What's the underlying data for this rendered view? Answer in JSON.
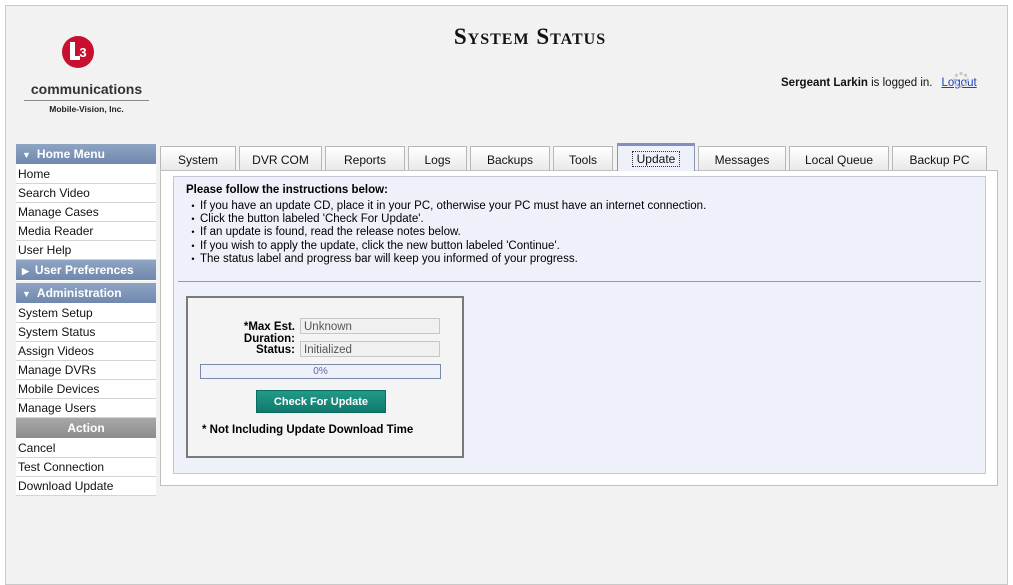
{
  "header": {
    "title": "System Status",
    "logo": {
      "brand": "L3",
      "name": "communications",
      "subtitle": "Mobile-Vision, Inc."
    },
    "user": "Sergeant Larkin",
    "logged_in_text": " is logged in.",
    "logout_label": "Logout"
  },
  "sidebar": {
    "home_menu_label": "Home Menu",
    "home_items": [
      "Home",
      "Search Video",
      "Manage Cases",
      "Media Reader",
      "User Help"
    ],
    "user_prefs_label": "User Preferences",
    "admin_label": "Administration",
    "admin_items": [
      "System Setup",
      "System Status",
      "Assign Videos",
      "Manage DVRs",
      "Mobile Devices",
      "Manage Users"
    ],
    "action_label": "Action",
    "action_items": [
      "Cancel",
      "Test Connection",
      "Download Update"
    ]
  },
  "tabs": [
    "System",
    "DVR COM",
    "Reports",
    "Logs",
    "Backups",
    "Tools",
    "Update",
    "Messages",
    "Local Queue",
    "Backup PC"
  ],
  "active_tab": "Update",
  "instructions": {
    "title": "Please follow the instructions below:",
    "items": [
      "If you have an update CD, place it in your PC, otherwise your PC must have an internet connection.",
      "Click the button labeled 'Check For Update'.",
      "If an update is found, read the release notes below.",
      "If you wish to apply the update, click the new button labeled 'Continue'.",
      "The status label and progress bar will keep you informed of your progress."
    ]
  },
  "update_panel": {
    "duration_label": "*Max Est. Duration:",
    "duration_value": "Unknown",
    "status_label": "Status:",
    "status_value": "Initialized",
    "progress_text": "0%",
    "progress_fraction": 0,
    "button_label": "Check For Update",
    "footnote": "* Not Including Update Download Time"
  },
  "colors": {
    "nav_header": "#7f93b6",
    "action_header": "#999999",
    "content_bg": "#eef0fa",
    "button": "#178a7b",
    "link": "#1a3fbf"
  }
}
